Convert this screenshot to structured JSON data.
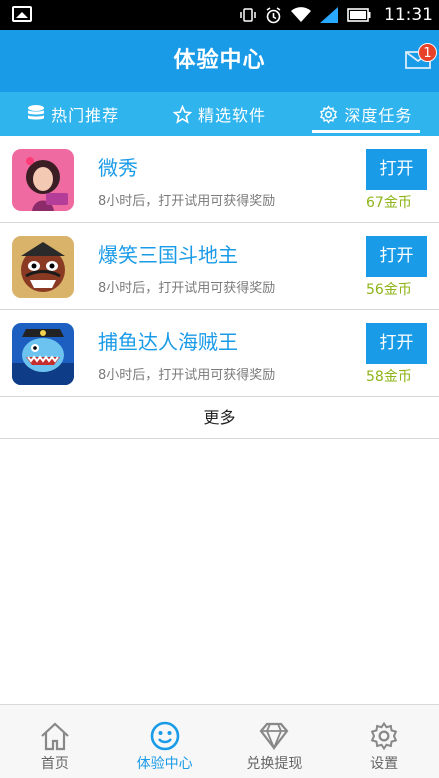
{
  "status_bar": {
    "time": "11:31",
    "icons": [
      "image-icon",
      "vibrate-icon",
      "alarm-icon",
      "wifi-icon",
      "signal-icon",
      "battery-icon"
    ]
  },
  "header": {
    "title": "体验中心",
    "mail_badge": "1"
  },
  "tabs": [
    {
      "label": "热门推荐",
      "icon": "database-icon",
      "active": false
    },
    {
      "label": "精选软件",
      "icon": "star-icon",
      "active": false
    },
    {
      "label": "深度任务",
      "icon": "gear-icon",
      "active": true
    }
  ],
  "apps": [
    {
      "name": "微秀",
      "desc": "8小时后，打开试用可获得奖励",
      "button": "打开",
      "coins": "67金币"
    },
    {
      "name": "爆笑三国斗地主",
      "desc": "8小时后，打开试用可获得奖励",
      "button": "打开",
      "coins": "56金币"
    },
    {
      "name": "捕鱼达人海贼王",
      "desc": "8小时后，打开试用可获得奖励",
      "button": "打开",
      "coins": "58金币"
    }
  ],
  "more_label": "更多",
  "bottom_nav": [
    {
      "label": "首页",
      "icon": "home-icon",
      "active": false
    },
    {
      "label": "体验中心",
      "icon": "smiley-icon",
      "active": true
    },
    {
      "label": "兑换提现",
      "icon": "diamond-icon",
      "active": false
    },
    {
      "label": "设置",
      "icon": "gear-icon",
      "active": false
    }
  ],
  "colors": {
    "header_blue": "#1a9be8",
    "tab_blue": "#30b4ee",
    "coin_green": "#8db418",
    "badge_red": "#e8412a"
  }
}
